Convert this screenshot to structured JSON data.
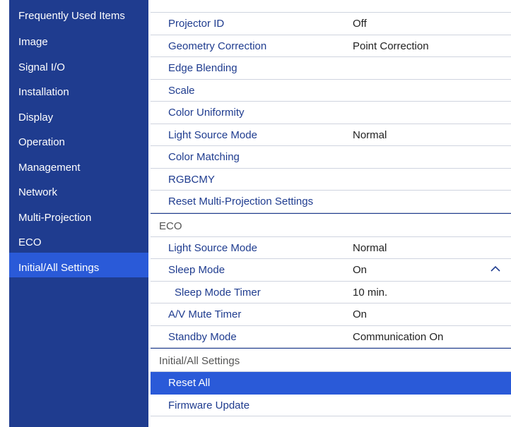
{
  "sidebar": {
    "items": [
      {
        "label": "Frequently Used Items"
      },
      {
        "label": "Image"
      },
      {
        "label": "Signal I/O"
      },
      {
        "label": "Installation"
      },
      {
        "label": "Display"
      },
      {
        "label": "Operation"
      },
      {
        "label": "Management"
      },
      {
        "label": "Network"
      },
      {
        "label": "Multi-Projection"
      },
      {
        "label": "ECO"
      },
      {
        "label": "Initial/All Settings"
      }
    ],
    "active": "Initial/All Settings",
    "colors": {
      "background": "#1f3c8f",
      "active": "#2a5ad8"
    }
  },
  "content": {
    "multi_projection_rows": [
      {
        "label": "Projector ID",
        "value": "Off"
      },
      {
        "label": "Geometry Correction",
        "value": "Point Correction"
      },
      {
        "label": "Edge Blending",
        "value": ""
      },
      {
        "label": "Scale",
        "value": ""
      },
      {
        "label": "Color Uniformity",
        "value": ""
      },
      {
        "label": "Light Source Mode",
        "value": "Normal"
      },
      {
        "label": "Color Matching",
        "value": ""
      },
      {
        "label": "RGBCMY",
        "value": ""
      },
      {
        "label": "Reset Multi-Projection Settings",
        "value": ""
      }
    ],
    "eco_section": {
      "title": "ECO",
      "rows": [
        {
          "label": "Light Source Mode",
          "value": "Normal"
        },
        {
          "label": "Sleep Mode",
          "value": "On",
          "expanded_icon": "chevron-up-icon"
        },
        {
          "label": "Sleep Mode Timer",
          "value": "10 min."
        },
        {
          "label": "A/V Mute Timer",
          "value": "On"
        },
        {
          "label": "Standby Mode",
          "value": "Communication On"
        }
      ]
    },
    "initial_section": {
      "title": "Initial/All Settings",
      "rows": [
        {
          "label": "Reset All",
          "selected": true
        },
        {
          "label": "Firmware Update"
        }
      ]
    },
    "colors": {
      "item_text": "#1f3c8f",
      "value_text": "#222222",
      "selected_bg": "#2a5ad8",
      "section_text": "#555555"
    }
  }
}
